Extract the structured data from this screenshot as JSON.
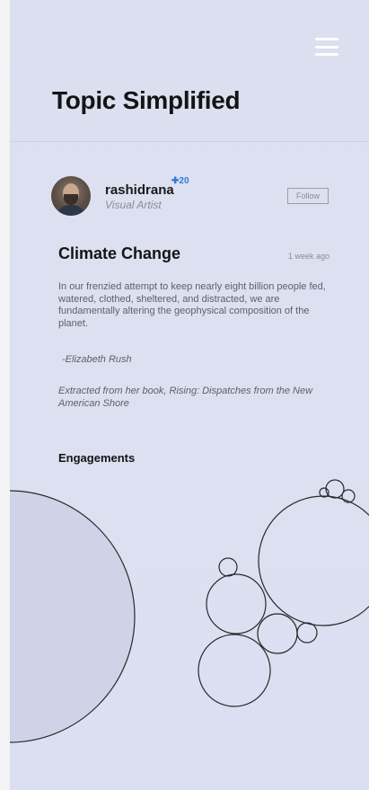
{
  "header": {
    "title": "Topic Simplified",
    "menu_icon": "hamburger-menu-icon"
  },
  "author": {
    "username": "rashidrana",
    "badge": "✚20",
    "role": "Visual Artist",
    "follow_label": "Follow"
  },
  "post": {
    "title": "Climate Change",
    "time": "1 week ago",
    "body": "In our frenzied attempt to keep nearly eight billion people fed, watered, clothed, sheltered, and distracted, we are fundamentally altering the geophysical composition of the planet.",
    "quote_author": "-Elizabeth Rush",
    "source": "Extracted from her book, Rising: Dispatches from the New American Shore"
  },
  "engagements": {
    "label": "Engagements"
  },
  "colors": {
    "background": "#dcdff0",
    "bubble_fill": "#d0d3e7",
    "badge": "#2e7bd6"
  }
}
